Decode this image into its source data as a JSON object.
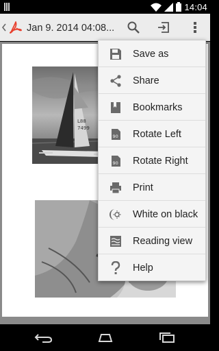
{
  "status_bar": {
    "time": "14:04",
    "icons": [
      "notification-icon",
      "wifi-icon",
      "cellular-signal-icon",
      "battery-icon"
    ]
  },
  "action_bar": {
    "title": "Jan 9. 2014 04:08...",
    "icons": [
      "back-icon",
      "pdf-logo-icon",
      "search-icon",
      "export-icon",
      "overflow-menu-icon"
    ]
  },
  "menu": {
    "items": [
      {
        "label": "Save as",
        "icon": "save-icon"
      },
      {
        "label": "Share",
        "icon": "share-icon"
      },
      {
        "label": "Bookmarks",
        "icon": "bookmark-icon"
      },
      {
        "label": "Rotate Left",
        "icon": "rotate-left-icon",
        "badge": "90"
      },
      {
        "label": "Rotate Right",
        "icon": "rotate-right-icon",
        "badge": "90"
      },
      {
        "label": "Print",
        "icon": "print-icon"
      },
      {
        "label": "White on black",
        "icon": "night-mode-icon"
      },
      {
        "label": "Reading view",
        "icon": "reading-view-icon"
      },
      {
        "label": "Help",
        "icon": "help-icon"
      }
    ]
  },
  "nav_bar": {
    "icons": [
      "back-nav-icon",
      "home-nav-icon",
      "recent-apps-icon"
    ]
  },
  "colors": {
    "action_bar_bg": "#ececec",
    "menu_bg": "#f4f4f4",
    "icon_gray": "#6a6a6a",
    "pdf_red": "#e8402e",
    "doc_background": "#8a8a8a"
  }
}
